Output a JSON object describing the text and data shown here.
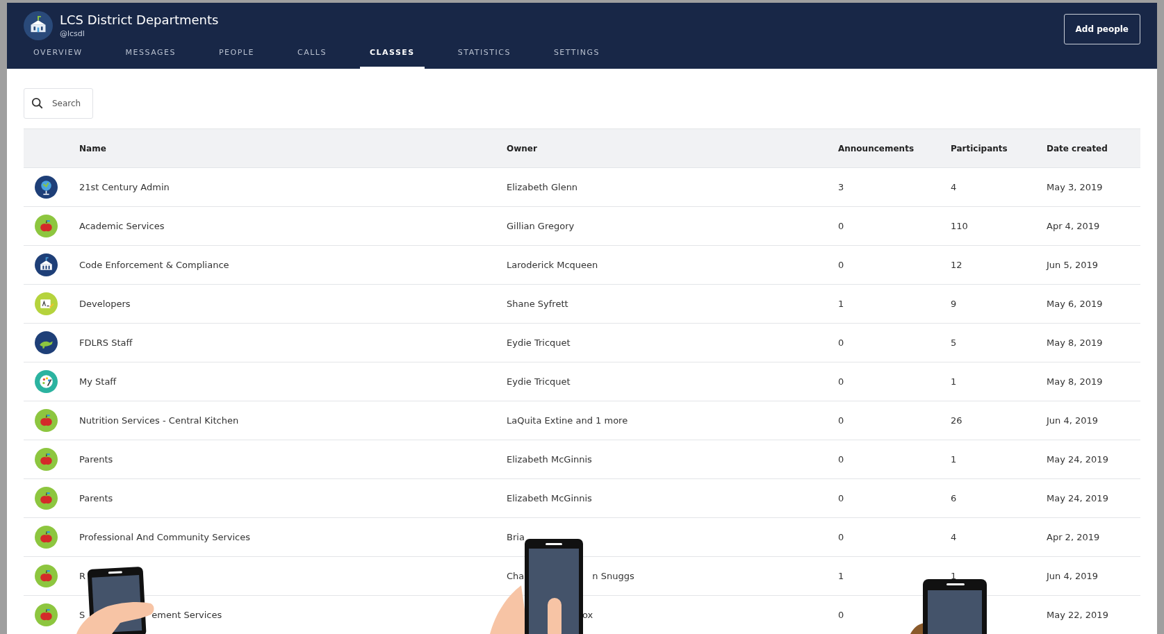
{
  "header": {
    "title": "LCS District Departments",
    "handle": "@lcsdl",
    "button": "Add people"
  },
  "tabs": [
    {
      "label": "OVERVIEW",
      "selected": false
    },
    {
      "label": "MESSAGES",
      "selected": false
    },
    {
      "label": "PEOPLE",
      "selected": false
    },
    {
      "label": "CALLS",
      "selected": false
    },
    {
      "label": "CLASSES",
      "selected": true
    },
    {
      "label": "STATISTICS",
      "selected": false
    },
    {
      "label": "SETTINGS",
      "selected": false
    }
  ],
  "search": {
    "placeholder": "Search"
  },
  "table": {
    "columns": [
      "Name",
      "Owner",
      "Announcements",
      "Participants",
      "Date created"
    ],
    "rows": [
      {
        "kind": "globe",
        "name": "21st Century Admin",
        "owner": "Elizabeth Glenn",
        "announcements": "3",
        "participants": "4",
        "date": "May 3, 2019"
      },
      {
        "kind": "apple",
        "name": "Academic Services",
        "owner": "Gillian Gregory",
        "announcements": "0",
        "participants": "110",
        "date": "Apr 4, 2019"
      },
      {
        "kind": "building",
        "name": "Code Enforcement & Compliance",
        "owner": "Laroderick Mcqueen",
        "announcements": "0",
        "participants": "12",
        "date": "Jun 5, 2019"
      },
      {
        "kind": "letters",
        "name": "Developers",
        "owner": "Shane Syfrett",
        "announcements": "1",
        "participants": "9",
        "date": "May 6, 2019"
      },
      {
        "kind": "dinosaur",
        "name": "FDLRS Staff",
        "owner": "Eydie Tricquet",
        "announcements": "0",
        "participants": "5",
        "date": "May 8, 2019"
      },
      {
        "kind": "palette",
        "name": "My Staff",
        "owner": "Eydie Tricquet",
        "announcements": "0",
        "participants": "1",
        "date": "May 8, 2019"
      },
      {
        "kind": "apple",
        "name": "Nutrition Services - Central Kitchen",
        "owner": "LaQuita Extine and 1 more",
        "announcements": "0",
        "participants": "26",
        "date": "Jun 4, 2019"
      },
      {
        "kind": "apple",
        "name": "Parents",
        "owner": "Elizabeth McGinnis",
        "announcements": "0",
        "participants": "1",
        "date": "May 24, 2019"
      },
      {
        "kind": "apple",
        "name": "Parents",
        "owner": "Elizabeth McGinnis",
        "announcements": "0",
        "participants": "6",
        "date": "May 24, 2019"
      },
      {
        "kind": "apple",
        "name": "Professional And Community Services",
        "owner": "Bria",
        "announcements": "0",
        "participants": "4",
        "date": "Apr 2, 2019"
      },
      {
        "kind": "apple",
        "name": "R",
        "owner": [
          "Cha",
          "n Snuggs"
        ],
        "announcements": "1",
        "participants": "1",
        "date": "Jun 4, 2019"
      },
      {
        "kind": "apple",
        "name": [
          "S",
          "ement Services"
        ],
        "owner_end": "ox",
        "announcements": "0",
        "date": "May 22, 2019"
      }
    ]
  }
}
